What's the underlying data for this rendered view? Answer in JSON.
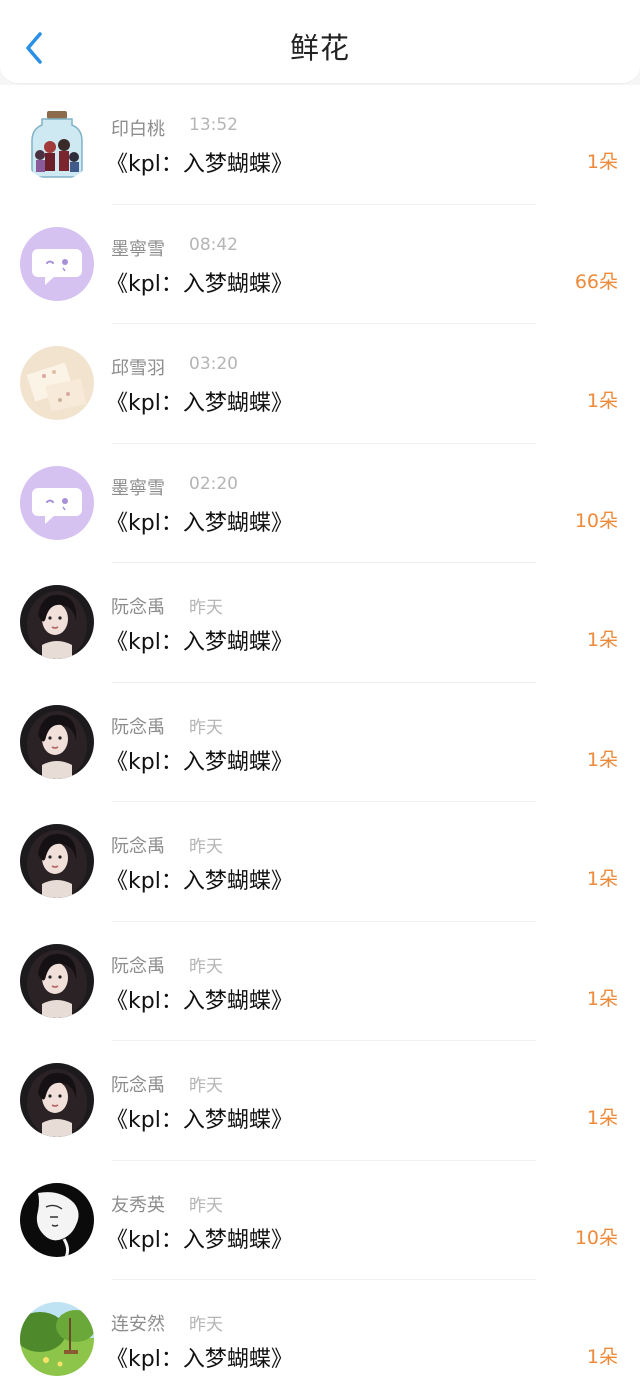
{
  "header": {
    "title": "鲜花",
    "back_icon": "chevron-left-icon"
  },
  "colors": {
    "accent": "#2a8fe6",
    "count": "#ee8a3a",
    "meta": "#8d8d8d"
  },
  "items": [
    {
      "name": "印白桃",
      "time": "13:52",
      "book": "《kpl：入梦蝴蝶》",
      "count": "1朵",
      "avatar": "jar-avatar"
    },
    {
      "name": "墨寧雪",
      "time": "08:42",
      "book": "《kpl：入梦蝴蝶》",
      "count": "66朵",
      "avatar": "chat-bubble-avatar"
    },
    {
      "name": "邱雪羽",
      "time": "03:20",
      "book": "《kpl：入梦蝴蝶》",
      "count": "1朵",
      "avatar": "paper-avatar"
    },
    {
      "name": "墨寧雪",
      "time": "02:20",
      "book": "《kpl：入梦蝴蝶》",
      "count": "10朵",
      "avatar": "chat-bubble-avatar"
    },
    {
      "name": "阮念禹",
      "time": "昨天",
      "book": "《kpl：入梦蝴蝶》",
      "count": "1朵",
      "avatar": "portrait-avatar"
    },
    {
      "name": "阮念禹",
      "time": "昨天",
      "book": "《kpl：入梦蝴蝶》",
      "count": "1朵",
      "avatar": "portrait-avatar"
    },
    {
      "name": "阮念禹",
      "time": "昨天",
      "book": "《kpl：入梦蝴蝶》",
      "count": "1朵",
      "avatar": "portrait-avatar"
    },
    {
      "name": "阮念禹",
      "time": "昨天",
      "book": "《kpl：入梦蝴蝶》",
      "count": "1朵",
      "avatar": "portrait-avatar"
    },
    {
      "name": "阮念禹",
      "time": "昨天",
      "book": "《kpl：入梦蝴蝶》",
      "count": "1朵",
      "avatar": "portrait-avatar"
    },
    {
      "name": "友秀英",
      "time": "昨天",
      "book": "《kpl：入梦蝴蝶》",
      "count": "10朵",
      "avatar": "sketch-avatar"
    },
    {
      "name": "连安然",
      "time": "昨天",
      "book": "《kpl：入梦蝴蝶》",
      "count": "1朵",
      "avatar": "meadow-avatar"
    }
  ]
}
